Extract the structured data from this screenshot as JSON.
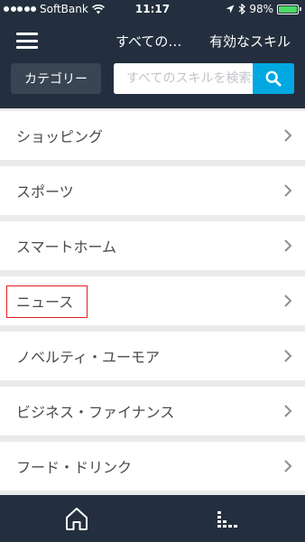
{
  "status_bar": {
    "carrier": "SoftBank",
    "time": "11:17",
    "battery_percent": "98%",
    "battery_level": 0.98,
    "battery_color": "#4cd964"
  },
  "header": {
    "title": "すべての…",
    "right_action": "有効なスキル",
    "category_button": "カテゴリー",
    "search_placeholder": "すべてのスキルを検索",
    "accent_color": "#00a8e1",
    "bar_color": "#232f3e"
  },
  "categories": [
    {
      "label": "ショッピング"
    },
    {
      "label": "スポーツ"
    },
    {
      "label": "スマートホーム"
    },
    {
      "label": "ニュース",
      "highlighted": true
    },
    {
      "label": "ノベルティ・ユーモア"
    },
    {
      "label": "ビジネス・ファイナンス"
    },
    {
      "label": "フード・ドリンク"
    }
  ],
  "bottom_tabs": [
    {
      "icon": "home-icon"
    },
    {
      "icon": "queue-icon"
    }
  ]
}
